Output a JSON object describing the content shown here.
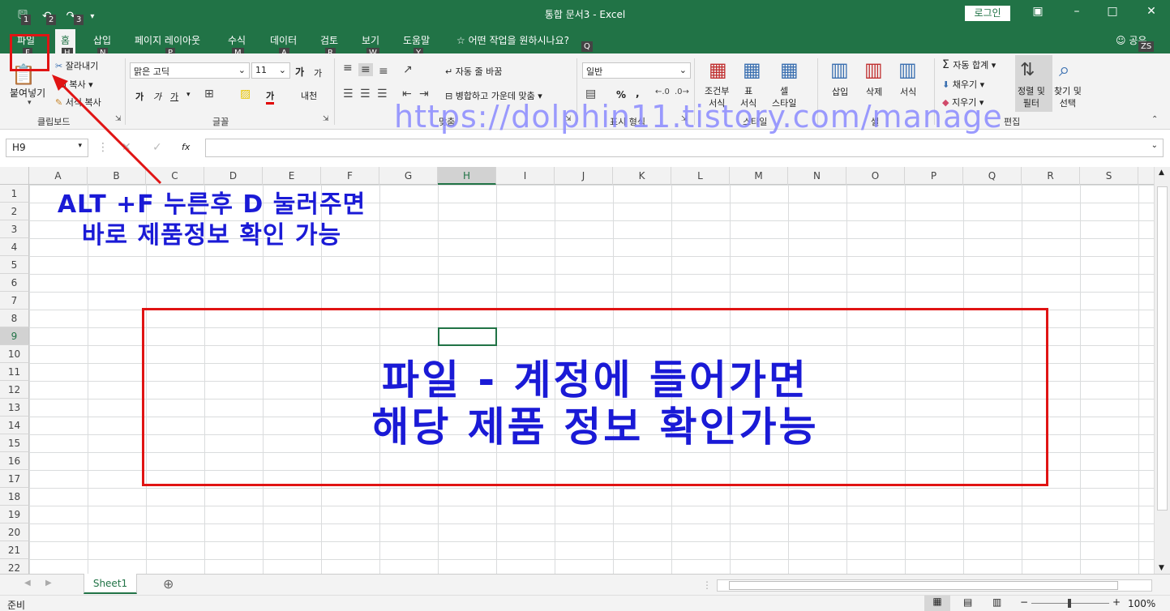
{
  "titlebar": {
    "title": "통합 문서3  -  Excel",
    "login": "로그인",
    "qat_keytips": [
      "1",
      "2",
      "3"
    ]
  },
  "tabs": [
    {
      "label": "파일",
      "keytip": "F"
    },
    {
      "label": "홈",
      "keytip": "H"
    },
    {
      "label": "삽입",
      "keytip": "N"
    },
    {
      "label": "페이지 레이아웃",
      "keytip": "P"
    },
    {
      "label": "수식",
      "keytip": "M"
    },
    {
      "label": "데이터",
      "keytip": "A"
    },
    {
      "label": "검토",
      "keytip": "R"
    },
    {
      "label": "보기",
      "keytip": "W"
    },
    {
      "label": "도움말",
      "keytip": "Y"
    }
  ],
  "tellme": {
    "text": "어떤 작업을 원하시나요?",
    "keytip": "Q"
  },
  "share": {
    "label": "공유",
    "keytip": "ZS"
  },
  "ribbon": {
    "clipboard": {
      "paste": "붙여넣기",
      "cut": "잘라내기",
      "copy": "복사",
      "format_painter": "서식 복사",
      "group": "클립보드"
    },
    "font": {
      "name": "맑은 고딕",
      "size": "11",
      "bold": "가",
      "italic": "가",
      "underline": "가",
      "color_char": "가",
      "phonetic": "내천",
      "grow": "가",
      "shrink": "가",
      "group": "글꼴"
    },
    "alignment": {
      "wrap": "자동 줄 바꿈",
      "merge": "병합하고 가운데 맞춤",
      "group": "맞춤"
    },
    "number": {
      "format": "일반",
      "percent": "%",
      "comma": ",",
      "group": "표시 형식"
    },
    "styles": {
      "conditional": "조건부\n서식",
      "table": "표\n서식",
      "cell": "셀\n스타일",
      "group": "스타일"
    },
    "cells": {
      "insert": "삽입",
      "delete": "삭제",
      "format": "서식",
      "group": "셀"
    },
    "editing": {
      "autosum": "자동 합계",
      "fill": "채우기",
      "clear": "지우기",
      "sort": "정렬 및\n필터",
      "find": "찾기 및\n선택",
      "group": "편집"
    }
  },
  "watermark": "https://dolphin11.tistory.com/manage",
  "formula": {
    "namebox": "H9",
    "fx": "fx",
    "value": ""
  },
  "columns": [
    "A",
    "B",
    "C",
    "D",
    "E",
    "F",
    "G",
    "H",
    "I",
    "J",
    "K",
    "L",
    "M",
    "N",
    "O",
    "P",
    "Q",
    "R",
    "S"
  ],
  "selected_column": "H",
  "rows": [
    "1",
    "2",
    "3",
    "4",
    "5",
    "6",
    "7",
    "8",
    "9",
    "10",
    "11",
    "12",
    "13",
    "14",
    "15",
    "16",
    "17",
    "18",
    "19",
    "20",
    "21",
    "22"
  ],
  "selected_row": "9",
  "annotation1": {
    "line1": "ALT +F 누른후 D 눌러주면",
    "line2": "바로 제품정보 확인 가능"
  },
  "annotation2": {
    "line1": "파일 - 계정에 들어가면",
    "line2": "해당 제품 정보 확인가능"
  },
  "sheet": {
    "name": "Sheet1"
  },
  "status": {
    "ready": "준비",
    "zoom": "100%"
  },
  "colors": {
    "excel_green": "#217346",
    "annotation_red": "#e01414",
    "annotation_blue": "#1a1ad6"
  }
}
